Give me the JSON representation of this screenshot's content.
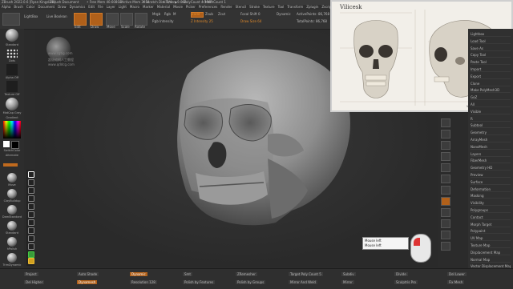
{
  "titlebar": {
    "app": "ZBrush 2022.0.6 [Ryan Kingslien]",
    "file": "ZBrush Document",
    "free_mem": "• Free Mem 40.608GB",
    "active_mem": "• Active Mem 3934",
    "scratch": "• Scratch Disk 0/4",
    "timer": "• Timer▶9.082",
    "polycount": "• PolyCount 4.5 MP",
    "meshcount": "• MeshCount 1"
  },
  "menus": [
    "Alpha",
    "Brush",
    "Color",
    "Document",
    "Draw",
    "Dynamics",
    "Edit",
    "File",
    "Layer",
    "Light",
    "Macro",
    "Marker",
    "Material",
    "Movie",
    "Picker",
    "Preferences",
    "Render",
    "Stencil",
    "Stroke",
    "Texture",
    "Tool",
    "Transform",
    "Zplugin",
    "Zscript",
    "Help"
  ],
  "toolbar": {
    "projection": "LightBox",
    "live_boolean": "Live Boolean",
    "edit": "Edit",
    "draw": "Draw",
    "move": "Move",
    "scale": "Scale",
    "rotate": "Rotate",
    "mrgb": "Mrgb",
    "rgb": "Rgb",
    "m": "M",
    "zadd": "Zadd",
    "zsub": "Zsub",
    "zcut": "Zcut",
    "rgb_intensity": "Rgb Intensity",
    "z_intensity": "Z Intensity 25",
    "focal_shift": "Focal Shift 0",
    "draw_size": "Draw Size 64",
    "dynamic": "Dynamic",
    "active_points": "ActivePoints: 86,768",
    "total_points": "TotalPoints: 86,768"
  },
  "left_shelf": {
    "brush_label": "Standard",
    "stroke_label": "Dots",
    "alpha_label": "Alpha Off",
    "texture_label": "Texture Off",
    "material_label": "MatCap Gray",
    "gradient_label": "Gradient",
    "switch_label": "SwitchColor",
    "alternate_label": "Alternate",
    "brushes": [
      "Move",
      "ClayBuildup",
      "DamStandard",
      "Standard",
      "hPolish",
      "TrimDynamic",
      "Inflat",
      "Pinch"
    ]
  },
  "watermark": {
    "site": "www.cgtig.com",
    "cn": "超級縮網人工教程",
    "url": "www.qddcg.com"
  },
  "reference": {
    "brand": "Vilicesk",
    "caption": "velicesk-anatomy.com"
  },
  "mouse_indicator": {
    "line1": "Mouse left",
    "line2": "Mouse left"
  },
  "right_panel": {
    "items": [
      "Lightbox",
      "Load Tool",
      "Save As",
      "Copy Tool",
      "Paste Tool",
      "Import",
      "Export",
      "Clone",
      "Make PolyMesh3D",
      "GoZ",
      "All",
      "Visible",
      "R",
      "Subtool",
      "Geometry",
      "ArrayMesh",
      "NanoMesh",
      "Layers",
      "FiberMesh",
      "Geometry HD",
      "Preview",
      "Surface",
      "Deformation",
      "Masking",
      "Visibility",
      "Polygroups",
      "Contact",
      "Morph Target",
      "Polypaint",
      "UV Map",
      "Texture Map",
      "Displacement Map",
      "Normal Map",
      "Vector Displacement Map"
    ]
  },
  "bottombar": {
    "items": [
      "Project",
      "Auto Shade",
      "Dynamic",
      "Smt",
      "ZRemesher",
      "Target Poly Count 5",
      "Subdiv",
      "Divide",
      "Del Lower",
      "Del Higher",
      "Dynamesh",
      "Resolution 128",
      "Polish by Features",
      "Polish by Groups",
      "Mirror And Weld",
      "Mirror",
      "Sculptris Pro",
      "Fix Mesh"
    ]
  },
  "colors": {
    "accent": "#e08a2a",
    "bg": "#2b2b2b"
  }
}
